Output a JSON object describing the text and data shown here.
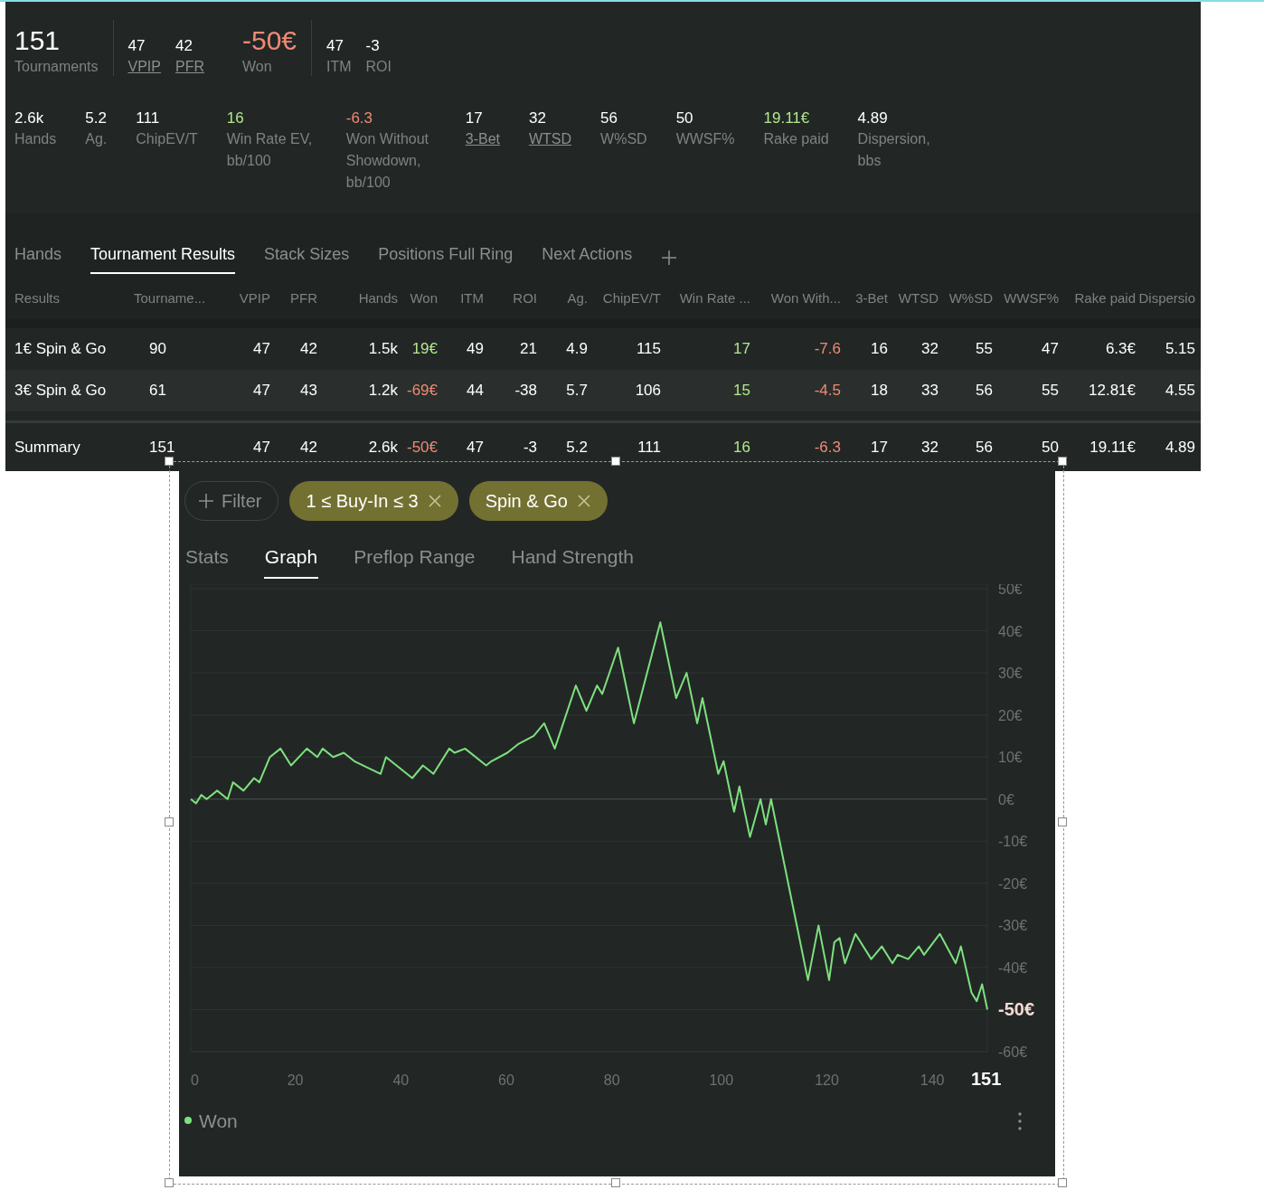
{
  "summary": {
    "groups": [
      [
        {
          "kind": "large",
          "value": "151",
          "label": "Tournaments",
          "link": false
        }
      ],
      [
        {
          "kind": "small",
          "value": "47",
          "label": "VPIP",
          "link": true
        },
        {
          "kind": "small",
          "value": "42",
          "label": "PFR",
          "link": true
        },
        {
          "kind": "large",
          "value": "-50€",
          "label": "Won",
          "color": "#f08a73",
          "link": false
        }
      ],
      [
        {
          "kind": "small",
          "value": "47",
          "label": "ITM",
          "link": false
        },
        {
          "kind": "small",
          "value": "-3",
          "label": "ROI",
          "link": false
        }
      ]
    ],
    "details": [
      {
        "value": "2.6k",
        "label": "Hands",
        "link": false
      },
      {
        "value": "5.2",
        "label": "Ag.",
        "link": false
      },
      {
        "value": "111",
        "label": "ChipEV/T",
        "link": false
      },
      {
        "value": "16",
        "label": "Win Rate EV, bb/100",
        "color": "#b4e88a",
        "link": false
      },
      {
        "value": "-6.3",
        "label": "Won Without Showdown, bb/100",
        "color": "#f08a73",
        "link": false
      },
      {
        "value": "17",
        "label": "3-Bet",
        "link": true
      },
      {
        "value": "32",
        "label": "WTSD",
        "link": true
      },
      {
        "value": "56",
        "label": "W%SD",
        "link": false
      },
      {
        "value": "50",
        "label": "WWSF%",
        "link": false
      },
      {
        "value": "19.11€",
        "label": "Rake paid",
        "color": "#b4e88a",
        "link": false
      },
      {
        "value": "4.89",
        "label": "Dispersion, bbs",
        "link": false
      }
    ]
  },
  "report_tabs": [
    {
      "label": "Hands",
      "selected": false
    },
    {
      "label": "Tournament Results",
      "selected": true
    },
    {
      "label": "Stack Sizes",
      "selected": false
    },
    {
      "label": "Positions Full Ring",
      "selected": false
    },
    {
      "label": "Next Actions",
      "selected": false
    }
  ],
  "table": {
    "columns": [
      "Results",
      "Tourname...",
      "VPIP",
      "PFR",
      "Hands",
      "Won",
      "ITM",
      "ROI",
      "Ag.",
      "ChipEV/T",
      "Win Rate ...",
      "Won With...",
      "3-Bet",
      "WTSD",
      "W%SD",
      "WWSF%",
      "Rake paid",
      "Dispersio"
    ],
    "rows": [
      {
        "kind": "data",
        "cells": [
          {
            "text": "1€ Spin & Go"
          },
          {
            "text": "90"
          },
          {
            "text": "47"
          },
          {
            "text": "42"
          },
          {
            "text": "1.5k"
          },
          {
            "text": "19€",
            "color": "#b4e88a"
          },
          {
            "text": "49"
          },
          {
            "text": "21"
          },
          {
            "text": "4.9"
          },
          {
            "text": "115"
          },
          {
            "text": "17",
            "color": "#b4e88a"
          },
          {
            "text": "-7.6",
            "color": "#f08a73"
          },
          {
            "text": "16"
          },
          {
            "text": "32"
          },
          {
            "text": "55"
          },
          {
            "text": "47"
          },
          {
            "text": "6.3€"
          },
          {
            "text": "5.15"
          }
        ]
      },
      {
        "kind": "data",
        "cells": [
          {
            "text": "3€ Spin & Go"
          },
          {
            "text": "61"
          },
          {
            "text": "47"
          },
          {
            "text": "43"
          },
          {
            "text": "1.2k"
          },
          {
            "text": "-69€",
            "color": "#f08a73"
          },
          {
            "text": "44"
          },
          {
            "text": "-38"
          },
          {
            "text": "5.7"
          },
          {
            "text": "106"
          },
          {
            "text": "15",
            "color": "#b4e88a"
          },
          {
            "text": "-4.5",
            "color": "#f08a73"
          },
          {
            "text": "18"
          },
          {
            "text": "33"
          },
          {
            "text": "56"
          },
          {
            "text": "55"
          },
          {
            "text": "12.81€"
          },
          {
            "text": "4.55"
          }
        ]
      },
      {
        "kind": "summary",
        "cells": [
          {
            "text": "Summary"
          },
          {
            "text": "151"
          },
          {
            "text": "47"
          },
          {
            "text": "42"
          },
          {
            "text": "2.6k"
          },
          {
            "text": "-50€",
            "color": "#f08a73"
          },
          {
            "text": "47"
          },
          {
            "text": "-3"
          },
          {
            "text": "5.2"
          },
          {
            "text": "111"
          },
          {
            "text": "16",
            "color": "#b4e88a"
          },
          {
            "text": "-6.3",
            "color": "#f08a73"
          },
          {
            "text": "17"
          },
          {
            "text": "32"
          },
          {
            "text": "56"
          },
          {
            "text": "50"
          },
          {
            "text": "19.11€"
          },
          {
            "text": "4.89"
          }
        ]
      }
    ]
  },
  "filters": [
    {
      "kind": "add",
      "label": "Filter"
    },
    {
      "kind": "chip",
      "label": "1 ≤ Buy-In ≤ 3"
    },
    {
      "kind": "chip",
      "label": "Spin & Go"
    }
  ],
  "view_tabs": [
    {
      "label": "Stats",
      "selected": false
    },
    {
      "label": "Graph",
      "selected": true
    },
    {
      "label": "Preflop Range",
      "selected": false
    },
    {
      "label": "Hand Strength",
      "selected": false
    }
  ],
  "graph": {
    "chart_data": {
      "type": "line",
      "grid": true,
      "xlim": [
        0,
        151
      ],
      "ylim": [
        -60,
        50
      ],
      "xticks": [
        0,
        20,
        40,
        60,
        80,
        100,
        120,
        140,
        {
          "value": 151,
          "label": "151"
        }
      ],
      "yticks": [
        {
          "value": 50,
          "label": "50€"
        },
        {
          "value": 40,
          "label": "40€"
        },
        {
          "value": 30,
          "label": "30€"
        },
        {
          "value": 20,
          "label": "20€"
        },
        {
          "value": 10,
          "label": "10€"
        },
        {
          "value": 0,
          "label": "0€"
        },
        {
          "value": -10,
          "label": "-10€"
        },
        {
          "value": -20,
          "label": "-20€"
        },
        {
          "value": -30,
          "label": "-30€"
        },
        {
          "value": -40,
          "label": "-40€"
        },
        {
          "value": -50,
          "label": "-50€"
        },
        {
          "value": -60,
          "label": "-60€"
        }
      ],
      "x": [
        0,
        1,
        2,
        3,
        5,
        7,
        8,
        10,
        12,
        13,
        15,
        17,
        19,
        22,
        24,
        25,
        27,
        29,
        31,
        36,
        37,
        42,
        44,
        46,
        49,
        50,
        52,
        56,
        57,
        60,
        62,
        65,
        67,
        69,
        73,
        75,
        77,
        78,
        81,
        84,
        89,
        92,
        94,
        96,
        97,
        100,
        101,
        103,
        104,
        106,
        108,
        109,
        110,
        117,
        119,
        121,
        122,
        123,
        124,
        126,
        129,
        131,
        133,
        134,
        136,
        138,
        139,
        142,
        145,
        146,
        148,
        149,
        150,
        151
      ],
      "series": [
        {
          "name": "Won",
          "color": "#7ee07e",
          "values": [
            0,
            -1,
            1,
            0,
            2,
            0,
            4,
            2,
            5,
            4,
            10,
            12,
            8,
            12,
            10,
            12,
            10,
            11,
            9,
            6,
            10,
            5,
            8,
            6,
            12,
            11,
            12,
            8,
            9,
            11,
            13,
            15,
            18,
            12,
            27,
            21,
            27,
            25,
            36,
            18,
            42,
            24,
            30,
            18,
            24,
            6,
            9,
            -3,
            3,
            -9,
            0,
            -6,
            0,
            -43,
            -30,
            -43,
            -34,
            -33,
            -39,
            -32,
            -38,
            -35,
            -39,
            -37,
            -38,
            -35,
            -37,
            -32,
            -39,
            -35,
            -46,
            -48,
            -44,
            -50
          ]
        }
      ]
    }
  }
}
